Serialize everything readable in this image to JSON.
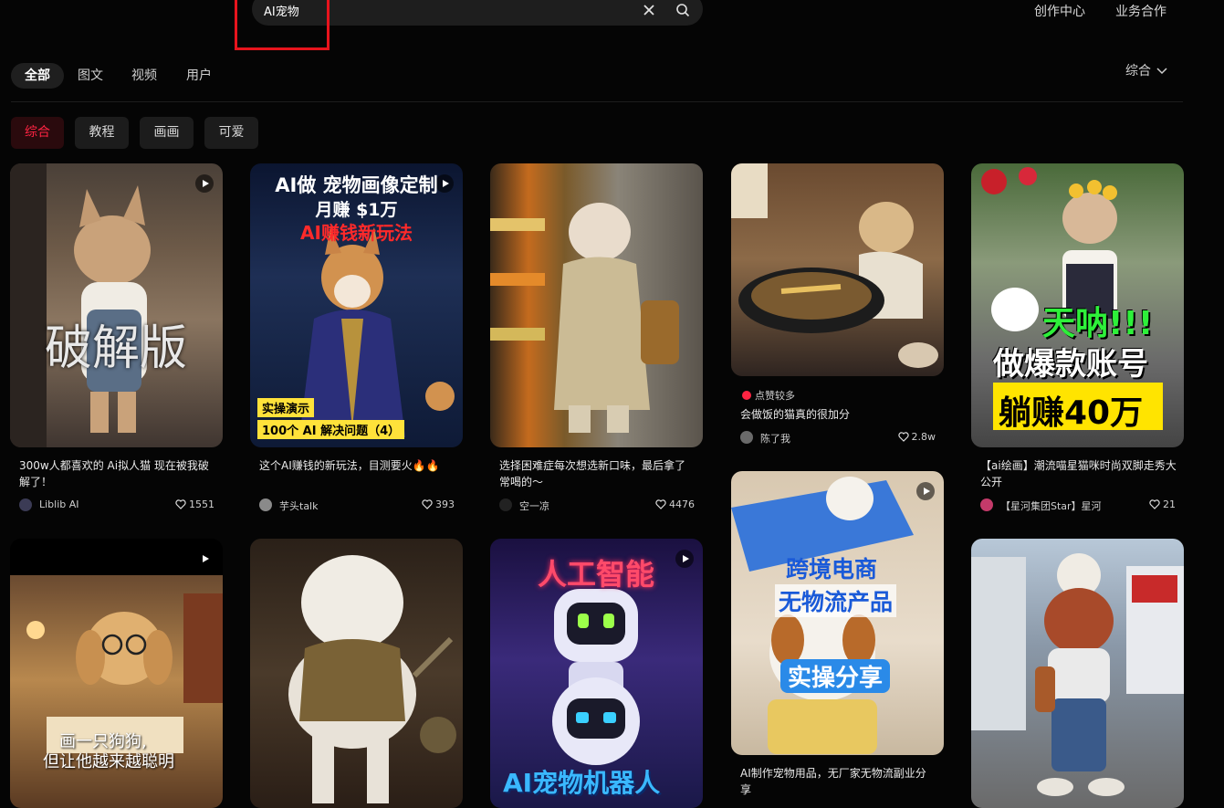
{
  "header": {
    "search_value": "AI宠物",
    "links": [
      "创作中心",
      "业务合作"
    ]
  },
  "tabs": [
    "全部",
    "图文",
    "视频",
    "用户"
  ],
  "sort_label": "综合",
  "chips": [
    "综合",
    "教程",
    "画画",
    "可爱"
  ],
  "colors": {
    "accent": "#ff2442",
    "annotation": "#e8141d",
    "background": "#050505"
  },
  "cards": [
    {
      "title": "300w人都喜欢的 Ai拟人猫 现在被我破解了！",
      "author": "Liblib AI",
      "likes": "1551",
      "overlay": "破解版"
    },
    {
      "title": "这个AI赚钱的新玩法，目测要火🔥🔥",
      "author": "芋头talk",
      "likes": "393",
      "overlay_lines": [
        "AI做 宠物画像定制",
        "月赚 $1万",
        "AI赚钱新玩法"
      ],
      "badge": "实操演示",
      "badge2": "100个 AI 解决问题（4）"
    },
    {
      "title": "选择困难症每次想选新口味，最后拿了常喝的～",
      "author": "空一凉",
      "likes": "4476"
    },
    {
      "hot": "点赞较多",
      "title": "会做饭的猫真的很加分",
      "author": "陈了我",
      "likes": "2.8w"
    },
    {
      "title": "【ai绘画】潮流喵星猫咪时尚双脚走秀大公开",
      "author": "【星河集团Star】星河",
      "likes": "21",
      "overlay_lines": [
        "天呐!!!",
        "做爆款账号",
        "躺赚40万"
      ]
    },
    {
      "overlay_lines": [
        "画一只狗狗,",
        "但让他越来越聪明"
      ]
    },
    {},
    {
      "overlay_lines": [
        "人工智能",
        "AI宠物机器人"
      ]
    },
    {
      "title": "AI制作宠物用品，无厂家无物流副业分享",
      "overlay_lines": [
        "跨境电商",
        "无物流产品",
        "实操分享"
      ]
    },
    {}
  ]
}
